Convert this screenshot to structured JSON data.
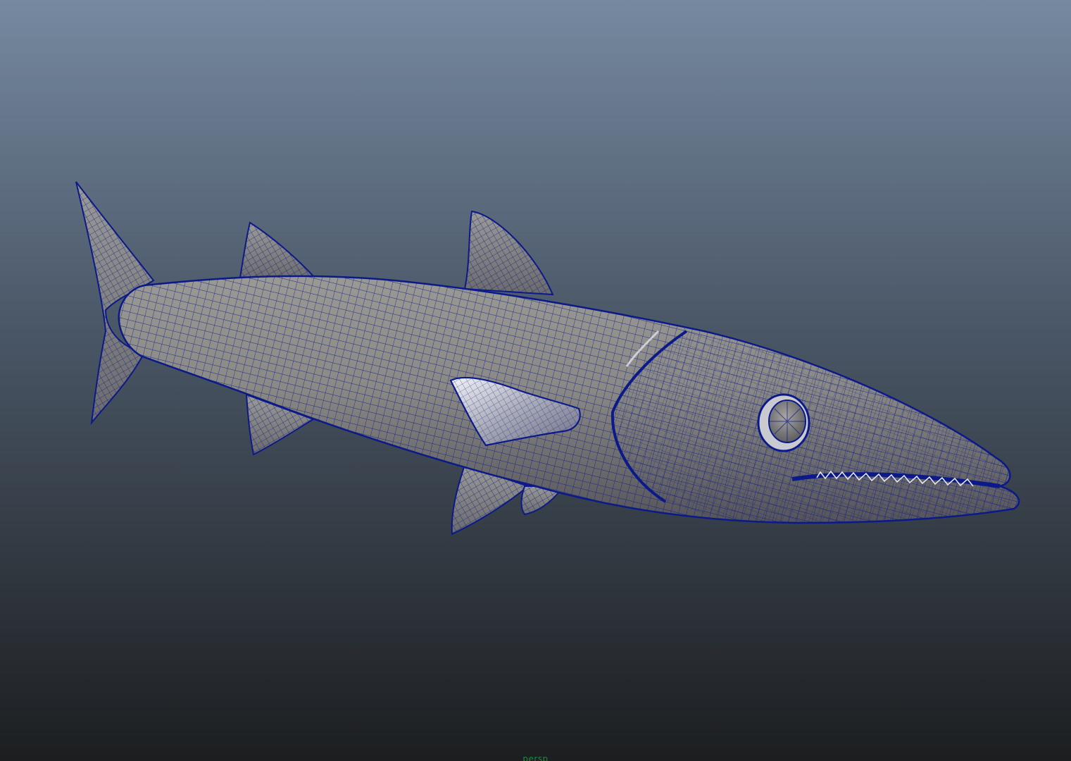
{
  "viewport": {
    "camera_name": "persp",
    "shading_mode": "smooth-shade-with-wireframe",
    "object": "barracuda-mesh"
  },
  "colors": {
    "background_top": "#7689a0",
    "background_mid": "#4b5868",
    "background_bottom": "#1c1e20",
    "wireframe": "#0b1a88",
    "surface_light": "#8d8d8a",
    "surface_dark": "#5b5a59",
    "camera_label": "#1f8a3a"
  }
}
